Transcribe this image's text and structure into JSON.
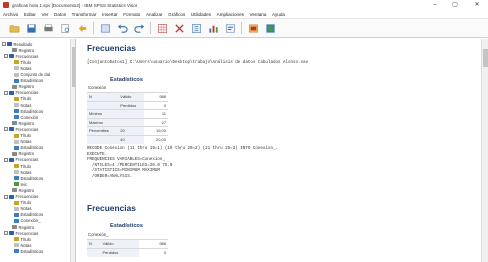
{
  "window": {
    "title": "graficas hola 1.spv [Documento2] - IBM SPSS Statistics Visor",
    "minimize": "–",
    "maximize": "▢",
    "close": "✕"
  },
  "menus": [
    "Archivo",
    "Editar",
    "Ver",
    "Datos",
    "Transformar",
    "Insertar",
    "Formato",
    "Analizar",
    "Gráficos",
    "Utilidades",
    "Ampliaciones",
    "Ventana",
    "Ayuda"
  ],
  "toolbar_icons": [
    "open-icon",
    "save-icon",
    "print-icon",
    "print-preview-icon",
    "export-icon",
    "recall-dialog-icon",
    "undo-icon",
    "redo-icon",
    "goto-data-icon",
    "goto-case-icon",
    "goto-variable-icon",
    "variables-icon",
    "insert-output-icon",
    "designate-window-icon",
    "create-graph-icon"
  ],
  "colors": {
    "accent": "#1f3d6b",
    "tree_book": "#2f5fa8",
    "icon_green": "#4a9a3a"
  },
  "outline": [
    {
      "label": "Resultado",
      "icon": "book",
      "expander": "-"
    },
    {
      "label": "Registro",
      "icon": "log"
    },
    {
      "label": "Frecuencias",
      "icon": "book",
      "expander": "-"
    },
    {
      "label": "Título",
      "icon": "title"
    },
    {
      "label": "Notas",
      "icon": "note"
    },
    {
      "label": "Conjunto de dat",
      "icon": "note"
    },
    {
      "label": "Estadísticos",
      "icon": "table"
    },
    {
      "label": "Registro",
      "icon": "log"
    },
    {
      "label": "Frecuencias",
      "icon": "book",
      "expander": "-"
    },
    {
      "label": "Título",
      "icon": "title"
    },
    {
      "label": "Notas",
      "icon": "note"
    },
    {
      "label": "Estadísticos",
      "icon": "table"
    },
    {
      "label": "Conexión",
      "icon": "table"
    },
    {
      "label": "Registro",
      "icon": "log"
    },
    {
      "label": "Frecuencias",
      "icon": "book",
      "expander": "-"
    },
    {
      "label": "Título",
      "icon": "title"
    },
    {
      "label": "Notas",
      "icon": "note"
    },
    {
      "label": "Estadísticos",
      "icon": "table"
    },
    {
      "label": "Registro",
      "icon": "log"
    },
    {
      "label": "Frecuencias",
      "icon": "book",
      "expander": "-"
    },
    {
      "label": "Título",
      "icon": "title"
    },
    {
      "label": "Notas",
      "icon": "note"
    },
    {
      "label": "Estadísticos",
      "icon": "table"
    },
    {
      "label": "Ieic",
      "icon": "check"
    },
    {
      "label": "Registro",
      "icon": "log"
    },
    {
      "label": "Frecuencias",
      "icon": "book",
      "expander": "-"
    },
    {
      "label": "Título",
      "icon": "title"
    },
    {
      "label": "Notas",
      "icon": "note"
    },
    {
      "label": "Estadísticos",
      "icon": "table"
    },
    {
      "label": "Conexión_",
      "icon": "table"
    },
    {
      "label": "Registro",
      "icon": "log"
    },
    {
      "label": "Frecuencias",
      "icon": "book",
      "expander": "-"
    },
    {
      "label": "Título",
      "icon": "title"
    },
    {
      "label": "Notas",
      "icon": "note"
    },
    {
      "label": "Estadísticos",
      "icon": "table"
    }
  ],
  "viewer": {
    "section1": {
      "heading": "Frecuencias",
      "dataset_line": "[ConjuntoDatos1] C:\\Users\\usuario\\Desktop\\trabajo\\Análisis de datos tabulados Alonso.sav",
      "table_title": "Estadísticos",
      "table_subtitle": "Conexión",
      "rows": [
        {
          "c1": "N",
          "c2": "Válido",
          "c3": "",
          "c4": "988"
        },
        {
          "c1": "",
          "c2": "Perdidos",
          "c3": "",
          "c4": "0"
        },
        {
          "c1": "Mínimo",
          "c2": "",
          "c3": "",
          "c4": "11"
        },
        {
          "c1": "Máximo",
          "c2": "",
          "c3": "",
          "c4": "27"
        },
        {
          "c1": "Percentiles",
          "c2": "20",
          "c3": "",
          "c4": "19,00"
        },
        {
          "c1": "",
          "c2": "40",
          "c3": "",
          "c4": "20,00"
        }
      ]
    },
    "syntax": [
      "RECODE Conexion (11 thru 19=1) (19 thru 20=2) (21 thru 25=3) INTO Conexion_.",
      "EXECUTE.",
      "FREQUENCIES VARIABLES=Conexion_",
      "  /NTILES=4 /PERCENTILES=20.0 75.0",
      "  /STATISTICS=MINIMUM MAXIMUM",
      "  /ORDER=ANALYSIS."
    ],
    "section2": {
      "heading": "Frecuencias",
      "table_title": "Estadísticos",
      "table_subtitle": "Conexión_",
      "rows": [
        {
          "c1": "N",
          "c2": "Válido",
          "c3": "",
          "c4": "988"
        },
        {
          "c1": "",
          "c2": "Perdidos",
          "c3": "",
          "c4": "0"
        }
      ]
    }
  }
}
